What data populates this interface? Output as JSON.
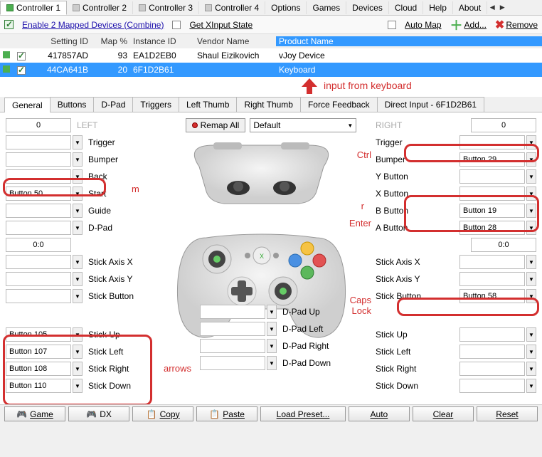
{
  "menubar": {
    "controller_tabs": [
      "Controller 1",
      "Controller 2",
      "Controller 3",
      "Controller 4"
    ],
    "items": [
      "Options",
      "Games",
      "Devices",
      "Cloud",
      "Help",
      "About"
    ]
  },
  "toolbar": {
    "enable_mapped": "Enable 2 Mapped Devices (Combine)",
    "get_xinput": "Get XInput State",
    "auto_map": "Auto Map",
    "add": "Add...",
    "remove": "Remove"
  },
  "grid": {
    "headers": [
      "",
      "",
      "Setting ID",
      "Map %",
      "Instance ID",
      "Vendor Name",
      "Product Name"
    ],
    "rows": [
      {
        "setting": "417857AD",
        "map": "93",
        "instance": "EA1D2EB0",
        "vendor": "Shaul Eizikovich",
        "product": "vJoy Device",
        "selected": false
      },
      {
        "setting": "44CA641B",
        "map": "20",
        "instance": "6F1D2B61",
        "vendor": "",
        "product": "Keyboard",
        "selected": true
      }
    ]
  },
  "annotation_kbd": "input from keyboard",
  "subtabs": [
    "General",
    "Buttons",
    "D-Pad",
    "Triggers",
    "Left Thumb",
    "Right Thumb",
    "Force Feedback",
    "Direct Input - 6F1D2B61"
  ],
  "top": {
    "left_zero": "0",
    "right_zero": "0",
    "left_lbl": "LEFT",
    "right_lbl": "RIGHT",
    "remap": "Remap All",
    "preset": "Default"
  },
  "left_rows": [
    {
      "val": "",
      "lbl": "Trigger"
    },
    {
      "val": "",
      "lbl": "Bumper"
    },
    {
      "val": "",
      "lbl": "Back"
    },
    {
      "val": "Button 50",
      "lbl": "Start"
    },
    {
      "val": "",
      "lbl": "Guide"
    },
    {
      "val": "",
      "lbl": "D-Pad"
    }
  ],
  "left_zerozero": "0:0",
  "left_axes": [
    {
      "val": "",
      "lbl": "Stick Axis X"
    },
    {
      "val": "",
      "lbl": "Stick Axis Y"
    },
    {
      "val": "",
      "lbl": "Stick Button"
    }
  ],
  "left_sticks": [
    {
      "val": "Button 105",
      "lbl": "Stick Up"
    },
    {
      "val": "Button 107",
      "lbl": "Stick Left"
    },
    {
      "val": "Button 108",
      "lbl": "Stick Right"
    },
    {
      "val": "Button 110",
      "lbl": "Stick Down"
    }
  ],
  "right_rows": [
    {
      "lbl": "Trigger",
      "val": ""
    },
    {
      "lbl": "Bumper",
      "val": "Button 29"
    },
    {
      "lbl": "Y Button",
      "val": ""
    },
    {
      "lbl": "X Button",
      "val": ""
    },
    {
      "lbl": "B Button",
      "val": "Button 19"
    },
    {
      "lbl": "A Button",
      "val": "Button 28"
    }
  ],
  "right_zerozero": "0:0",
  "right_axes": [
    {
      "lbl": "Stick Axis X",
      "val": ""
    },
    {
      "lbl": "Stick Axis Y",
      "val": ""
    },
    {
      "lbl": "Stick Button",
      "val": "Button 58"
    }
  ],
  "right_sticks": [
    {
      "lbl": "Stick Up",
      "val": ""
    },
    {
      "lbl": "Stick Left",
      "val": ""
    },
    {
      "lbl": "Stick Right",
      "val": ""
    },
    {
      "lbl": "Stick Down",
      "val": ""
    }
  ],
  "dpad_center": [
    "D-Pad Up",
    "D-Pad Left",
    "D-Pad Right",
    "D-Pad Down"
  ],
  "annots": {
    "m": "m",
    "ctrl": "Ctrl",
    "r": "r",
    "enter": "Enter",
    "caps": "Caps\nLock",
    "arrows": "arrows"
  },
  "bottom": [
    "Game",
    "DX",
    "Copy",
    "Paste",
    "Load Preset...",
    "Auto",
    "Clear",
    "Reset"
  ]
}
